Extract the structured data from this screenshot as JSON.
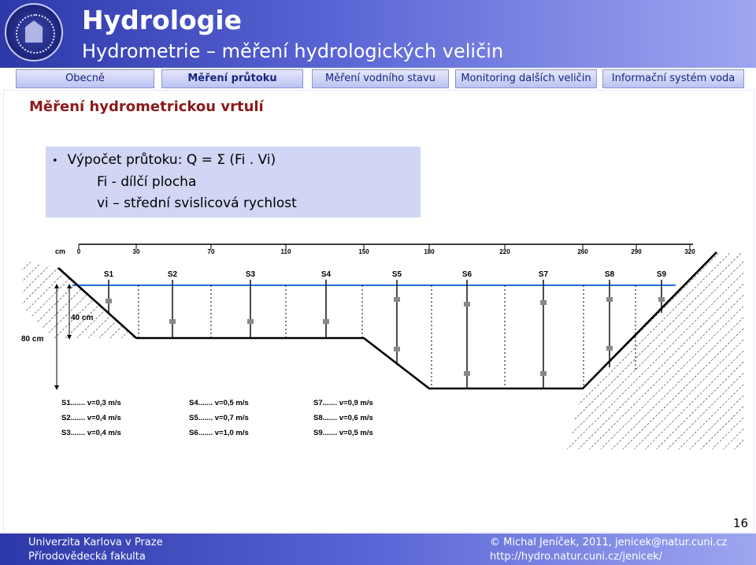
{
  "header": {
    "title": "Hydrologie",
    "subtitle": "Hydrometrie – měření hydrologických veličin"
  },
  "nav": {
    "tabs": [
      {
        "label": "Obecně",
        "active": false
      },
      {
        "label": "Měření průtoku",
        "active": true
      },
      {
        "label": "Měření vodního stavu",
        "active": false
      },
      {
        "label": "Monitoring dalších veličin",
        "active": false
      },
      {
        "label": "Informační systém voda",
        "active": false
      }
    ]
  },
  "slide": {
    "title": "Měření hydrometrickou vrtulí",
    "formula_line1": "Výpočet průtoku: Q = Σ (Fi . Vi)",
    "formula_line2": "Fi - dílčí plocha",
    "formula_line3": "vi – střední svislicová rychlost",
    "bullet": "•"
  },
  "diagram": {
    "unit": "cm",
    "ticks": [
      "0",
      "30",
      "70",
      "110",
      "150",
      "180",
      "220",
      "260",
      "290",
      "320"
    ],
    "verticals": [
      "S1",
      "S2",
      "S3",
      "S4",
      "S5",
      "S6",
      "S7",
      "S8",
      "S9"
    ],
    "depth_label_small": "40 cm",
    "depth_label_large": "80 cm",
    "velocities": [
      "S1....... v=0,3 m/s",
      "S2....... v=0,4 m/s",
      "S3....... v=0,4 m/s",
      "S4....... v=0,5 m/s",
      "S5....... v=0,7 m/s",
      "S6....... v=1,0 m/s",
      "S7....... v=0,9 m/s",
      "S8....... v=0,6 m/s",
      "S9....... v=0,5 m/s"
    ]
  },
  "page_number": "16",
  "footer": {
    "university": "Univerzita Karlova v Praze",
    "faculty": "Přírodovědecká fakulta",
    "copyright": "© Michal Jeníček, 2011, jenicek@natur.cuni.cz",
    "url": "http://hydro.natur.cuni.cz/jenicek/"
  },
  "colors": {
    "header_blue": "#2d39a8",
    "title_red": "#8b1a1a",
    "formula_bg": "#d0d6f4",
    "water_line": "#1e6fd9"
  }
}
